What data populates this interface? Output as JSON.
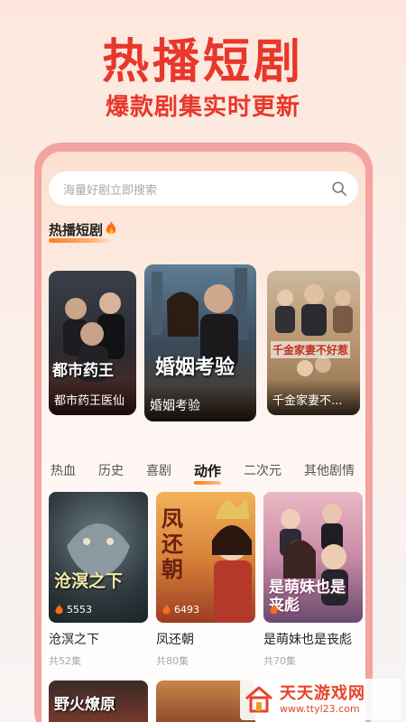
{
  "promo": {
    "headline": "热播短剧",
    "subheadline": "爆款剧集实时更新"
  },
  "search": {
    "placeholder": "海量好剧立即搜索",
    "icon": "search-icon"
  },
  "hot_section": {
    "title": "热播短剧",
    "icon": "fire-icon",
    "items": [
      {
        "label": "都市药王医仙",
        "poster_text": "都市药王"
      },
      {
        "label": "婚姻考验",
        "poster_text": "婚姻考验"
      },
      {
        "label": "千金家妻不...",
        "poster_text": "千金家妻不好惹"
      }
    ]
  },
  "tabs": {
    "items": [
      "热血",
      "历史",
      "喜剧",
      "动作",
      "二次元",
      "其他剧情"
    ],
    "active": "动作"
  },
  "grid": {
    "items": [
      {
        "title": "沧溟之下",
        "views": "5553",
        "episodes": "共52集",
        "poster_text": "沧溟之下"
      },
      {
        "title": "凤还朝",
        "views": "6493",
        "episodes": "共80集",
        "poster_text": "凤还朝"
      },
      {
        "title": "是萌妹也是丧彪",
        "views": "",
        "episodes": "共70集",
        "poster_text": "是萌妹也是丧彪"
      }
    ],
    "peek_text": "野火燎原"
  },
  "watermark": {
    "name": "天天游戏网",
    "url": "www.ttyl23.com"
  },
  "colors": {
    "accent": "#e8372b",
    "tab_underline": "#ff7a1a",
    "phone_frame": "#f3a3a0"
  }
}
